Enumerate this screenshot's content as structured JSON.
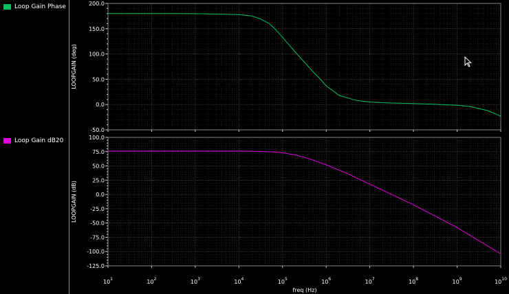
{
  "legend": [
    {
      "label": "Loop Gain Phase",
      "color": "#00c060"
    },
    {
      "label": "Loop Gain dB20",
      "color": "#e000e0"
    }
  ],
  "x_axis": {
    "label": "freq (Hz)",
    "ticks": [
      {
        "base": "10",
        "exp": "1"
      },
      {
        "base": "10",
        "exp": "2"
      },
      {
        "base": "10",
        "exp": "3"
      },
      {
        "base": "10",
        "exp": "4"
      },
      {
        "base": "10",
        "exp": "5"
      },
      {
        "base": "10",
        "exp": "6"
      },
      {
        "base": "10",
        "exp": "7"
      },
      {
        "base": "10",
        "exp": "8"
      },
      {
        "base": "10",
        "exp": "9"
      },
      {
        "base": "10",
        "exp": "10"
      }
    ]
  },
  "chart_data": [
    {
      "type": "line",
      "ylabel": "LOOPGAIN (deg)",
      "xlabel": "",
      "x_scale": "log",
      "xlim": [
        10,
        10000000000
      ],
      "ylim": [
        -50,
        200
      ],
      "yticks": [
        "200.0",
        "150.0",
        "100.0",
        "50.0",
        "0.0",
        "-50.0"
      ],
      "grid": true,
      "series": [
        {
          "name": "Loop Gain Phase",
          "color": "#00c060",
          "x": [
            10,
            100,
            1000,
            10000,
            20000,
            30000,
            50000,
            70000,
            100000,
            200000,
            300000,
            500000,
            700000,
            1000000,
            2000000,
            5000000,
            10000000,
            30000000,
            100000000,
            300000000,
            1000000000,
            2000000000,
            5000000000,
            10000000000
          ],
          "y": [
            180,
            180,
            179.8,
            178,
            175,
            170,
            160,
            148,
            133,
            103,
            86,
            65,
            52,
            37,
            18,
            8,
            5,
            3,
            2,
            0.5,
            -1.5,
            -4,
            -12,
            -23
          ]
        }
      ]
    },
    {
      "type": "line",
      "ylabel": "LOOPGAIN (dB)",
      "xlabel": "freq (Hz)",
      "x_scale": "log",
      "xlim": [
        10,
        10000000000
      ],
      "ylim": [
        -125,
        100
      ],
      "yticks": [
        "100.0",
        "75.0",
        "50.0",
        "25.0",
        "0.0",
        "-25.0",
        "-50.0",
        "-75.0",
        "-100.0",
        "-125.0"
      ],
      "grid": true,
      "series": [
        {
          "name": "Loop Gain dB20",
          "color": "#e000e0",
          "x": [
            10,
            100,
            1000,
            10000,
            30000,
            60000,
            100000,
            200000,
            300000,
            500000,
            1000000,
            3000000,
            10000000,
            100000000,
            1000000000,
            10000000000
          ],
          "y": [
            76,
            76,
            76,
            76,
            75.5,
            74.5,
            73,
            69,
            65.5,
            60,
            52,
            37,
            18,
            -18,
            -58,
            -104
          ]
        }
      ]
    }
  ]
}
